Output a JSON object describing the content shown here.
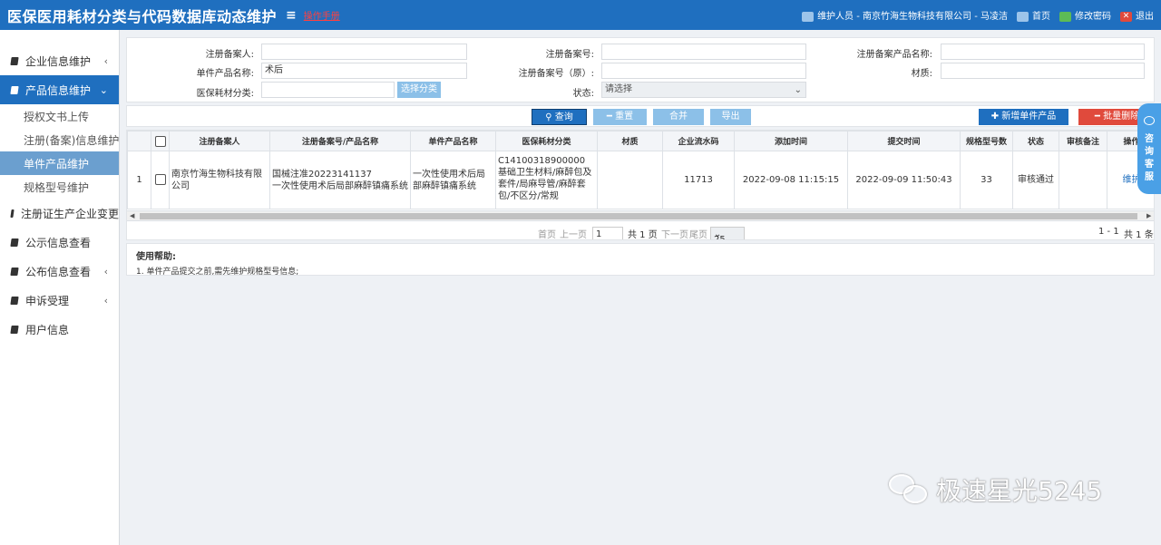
{
  "header": {
    "title": "医保医用耗材分类与代码数据库动态维护",
    "manual_link": "操作手册",
    "user_info": "维护人员 - 南京竹海生物科技有限公司 - 马凌洁",
    "home": "首页",
    "change_password": "修改密码",
    "logout": "退出"
  },
  "sidebar": {
    "items": [
      {
        "label": "企业信息维护"
      },
      {
        "label": "产品信息维护"
      },
      {
        "label": "注册证生产企业变更"
      },
      {
        "label": "公示信息查看"
      },
      {
        "label": "公布信息查看"
      },
      {
        "label": "申诉受理"
      },
      {
        "label": "用户信息"
      }
    ],
    "subitems": [
      {
        "label": "授权文书上传"
      },
      {
        "label": "注册(备案)信息维护"
      },
      {
        "label": "单件产品维护"
      },
      {
        "label": "规格型号维护"
      }
    ]
  },
  "search": {
    "registrant_label": "注册备案人:",
    "registrant_value": "",
    "reg_no_label": "注册备案号:",
    "reg_no_value": "",
    "reg_product_name_label": "注册备案产品名称:",
    "reg_product_name_value": "",
    "single_product_label": "单件产品名称:",
    "single_product_value": "术后",
    "reg_no_orig_label": "注册备案号（原）:",
    "reg_no_orig_value": "",
    "material_label": "材质:",
    "material_value": "",
    "category_label": "医保耗材分类:",
    "category_value": "",
    "select_category_button": "选择分类",
    "status_label": "状态:",
    "status_value": "请选择"
  },
  "actions": {
    "query": "查询",
    "reset": "重置",
    "merge": "合并",
    "export": "导出",
    "add_single": "新增单件产品",
    "batch_delete": "批量删除"
  },
  "table": {
    "headers": [
      "",
      "",
      "注册备案人",
      "注册备案号/产品名称",
      "单件产品名称",
      "医保耗材分类",
      "材质",
      "企业流水码",
      "添加时间",
      "提交时间",
      "规格型号数",
      "状态",
      "审核备注",
      "操作"
    ],
    "rows": [
      {
        "index": "1",
        "registrant": "南京竹海生物科技有限公司",
        "reg_no": "国械注准20223141137",
        "reg_product": "一次性使用术后局部麻醉镇痛系统",
        "single_product": "一次性使用术后局部麻醉镇痛系统",
        "category_code": "C14100318900000",
        "category_desc": "基础卫生材料/麻醉包及套件/局麻导管/麻醉套包/不区分/常规",
        "material": "",
        "serial": "11713",
        "added": "2022-09-08 11:15:15",
        "submitted": "2022-09-09 11:50:43",
        "spec_count": "33",
        "status": "审核通过",
        "remark": "",
        "op": "维护"
      }
    ]
  },
  "pager": {
    "first": "首页",
    "prev": "上一页",
    "page_value": "1",
    "total_pages": "共 1 页",
    "next": "下一页",
    "last": "尾页",
    "page_size": "25",
    "range": "1 - 1",
    "total": "共 1 条"
  },
  "help": {
    "title": "使用帮助:",
    "text": "1. 单件产品提交之前,需先维护规格型号信息;"
  },
  "float_service": {
    "label": "咨询客服"
  },
  "watermark": {
    "text": "极速星光5245"
  }
}
